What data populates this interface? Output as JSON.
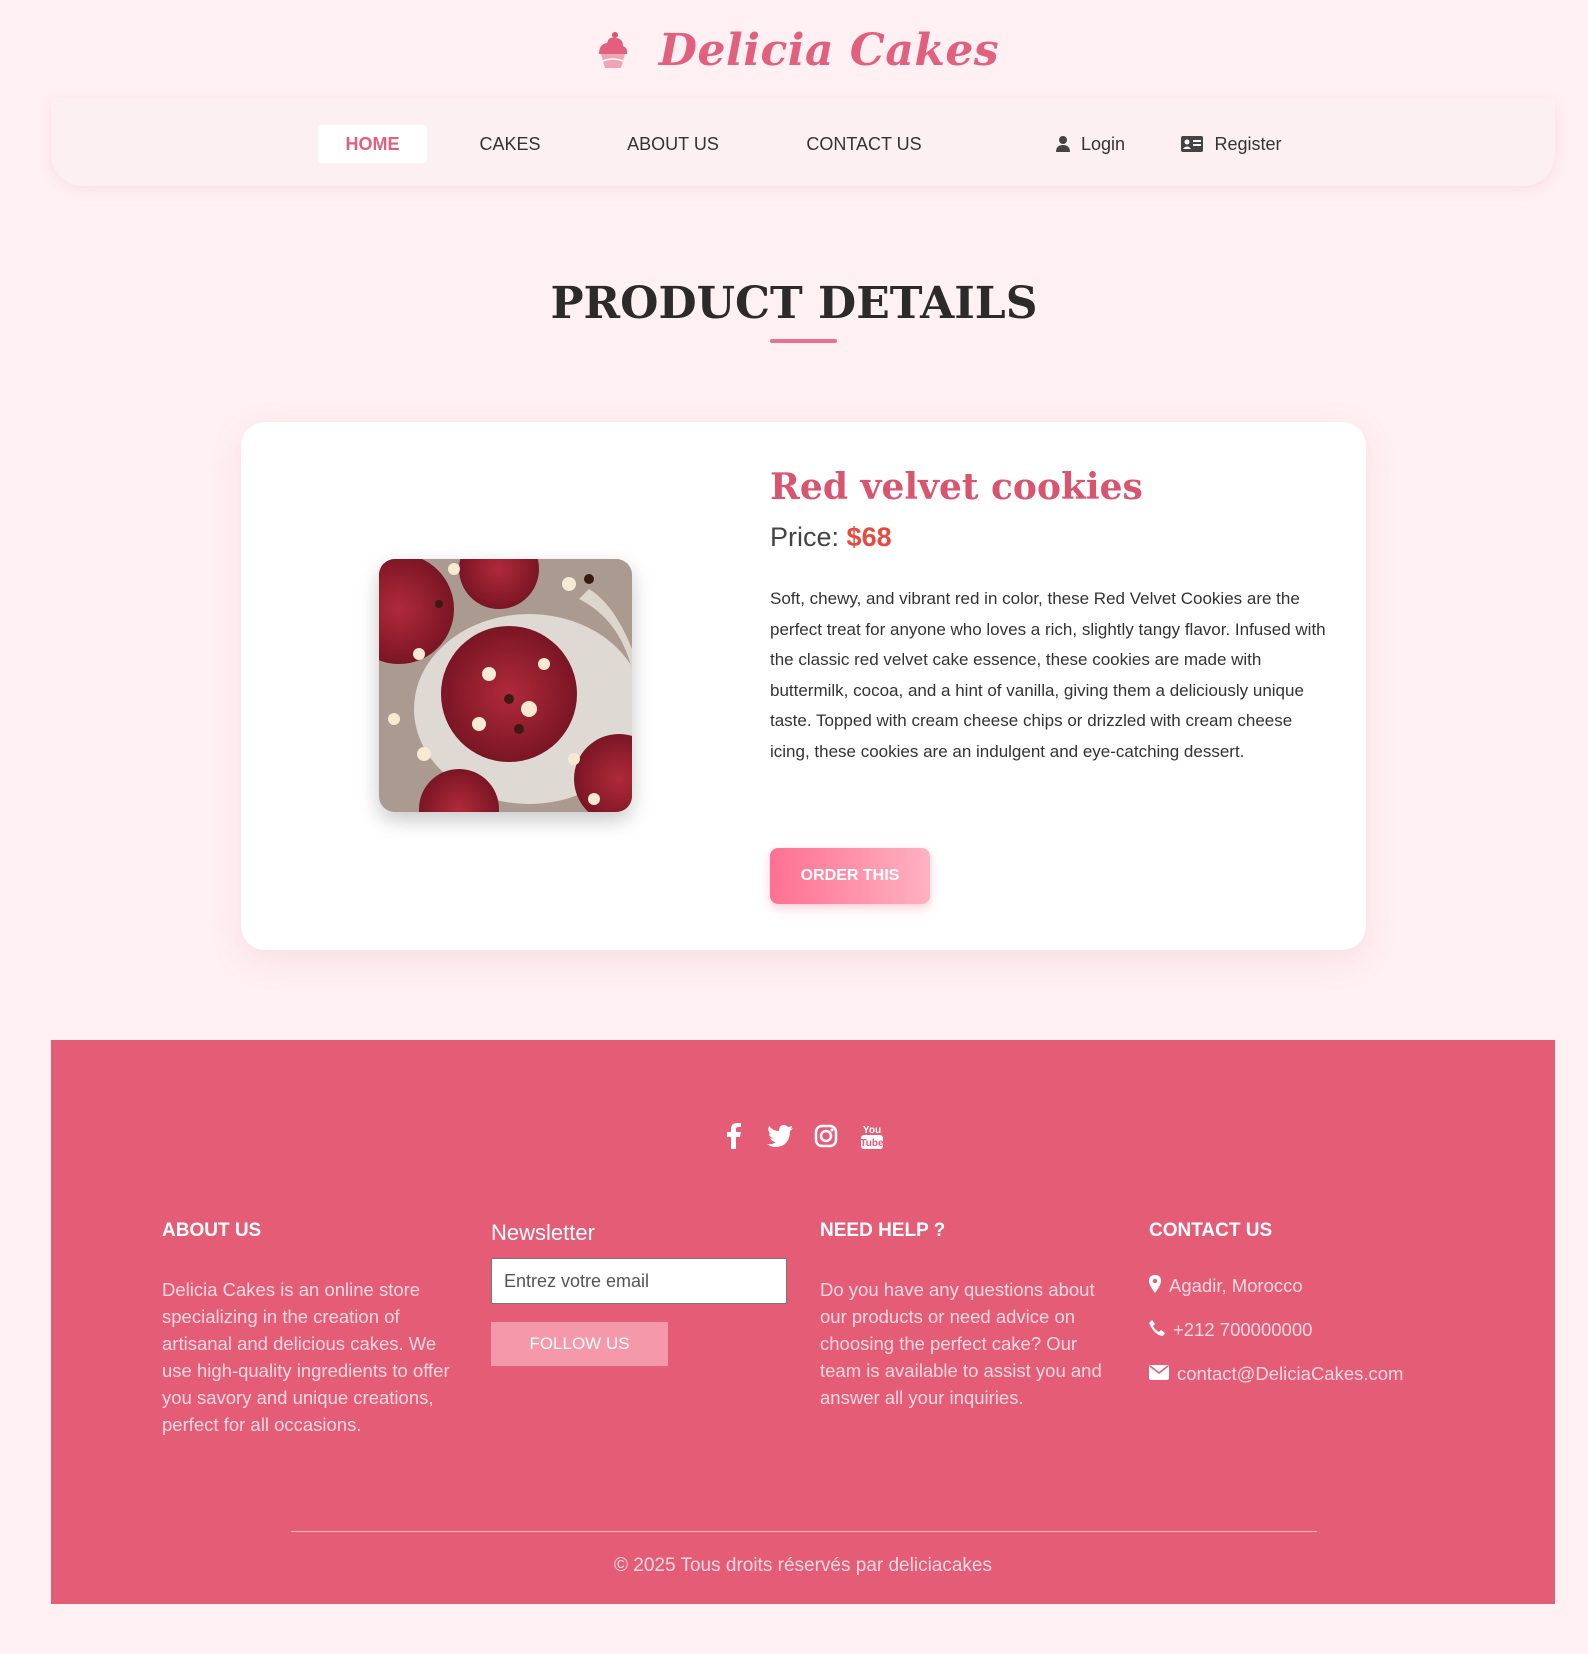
{
  "brand": {
    "name": "Delicia Cakes",
    "logo_icon": "cupcake-logo-icon"
  },
  "nav": {
    "home": "HOME",
    "cakes": "CAKES",
    "about": "ABOUT US",
    "contact": "CONTACT US",
    "login": "Login",
    "register": "Register",
    "login_icon": "user-icon",
    "register_icon": "id-card-icon",
    "active": "HOME"
  },
  "page": {
    "title": "PRODUCT DETAILS"
  },
  "product": {
    "name": "Red velvet cookies",
    "price_label": "Price:",
    "price": "$68",
    "description": "Soft, chewy, and vibrant red in color, these Red Velvet Cookies are the perfect treat for anyone who loves a rich, slightly tangy flavor. Infused with the classic red velvet cake essence, these cookies are made with buttermilk, cocoa, and a hint of vanilla, giving them a deliciously unique taste. Topped with cream cheese chips or drizzled with cream cheese icing, these cookies are an indulgent and eye-catching dessert.",
    "order_button": "ORDER THIS"
  },
  "footer": {
    "socials": [
      "facebook-icon",
      "twitter-icon",
      "instagram-icon",
      "youtube-icon"
    ],
    "about": {
      "title": "ABOUT US",
      "text": "Delicia Cakes is an online store specializing in the creation of artisanal and delicious cakes. We use high-quality ingredients to offer you savory and unique creations, perfect for all occasions."
    },
    "newsletter": {
      "title": "Newsletter",
      "placeholder": "Entrez votre email",
      "button": "FOLLOW US"
    },
    "help": {
      "title": "NEED HELP ?",
      "text": "Do you have any questions about our products or need advice on choosing the perfect cake? Our team is available to assist you and answer all your inquiries."
    },
    "contact": {
      "title": "CONTACT US",
      "address": "Agadir, Morocco",
      "phone": "+212 700000000",
      "email": "contact@DeliciaCakes.com"
    },
    "copyright": "© 2025 Tous droits réservés par deliciacakes"
  },
  "colors": {
    "page_bg": "#fff0f3",
    "accent": "#e0607e",
    "footer_bg": "#e45c76",
    "price": "#e84a3f"
  }
}
